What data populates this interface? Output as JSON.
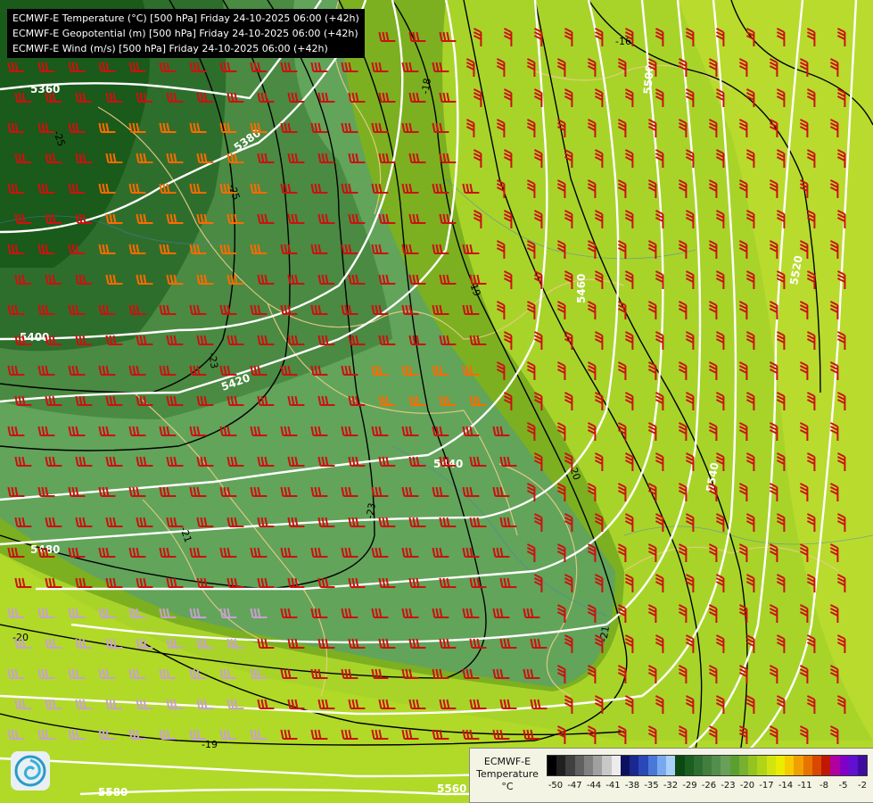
{
  "titles": [
    "ECMWF-E Temperature (°C) [500 hPa] Friday 24-10-2025 06:00 (+42h)",
    "ECMWF-E Geopotential (m) [500 hPa] Friday 24-10-2025 06:00 (+42h)",
    "ECMWF-E Wind (m/s) [500 hPa] Friday 24-10-2025 06:00 (+42h)"
  ],
  "legend": {
    "model": "ECMWF-E",
    "variable": "Temperature",
    "unit": "°C",
    "ticks": [
      "-50",
      "-47",
      "-44",
      "-41",
      "-38",
      "-35",
      "-32",
      "-29",
      "-26",
      "-23",
      "-20",
      "-17",
      "-14",
      "-11",
      "-8",
      "-5",
      "-2"
    ],
    "colors": [
      "#000000",
      "#202020",
      "#404040",
      "#606060",
      "#808080",
      "#a0a0a0",
      "#c8c8c8",
      "#ececec",
      "#0c1060",
      "#1a2890",
      "#2a48b8",
      "#4a78d8",
      "#78a8f0",
      "#a8d0f8",
      "#0a4a12",
      "#1c5e20",
      "#2e6e30",
      "#427e3e",
      "#548e4c",
      "#68a05a",
      "#5aa030",
      "#78b030",
      "#94c420",
      "#b2d418",
      "#d2e410",
      "#ecec00",
      "#f6cc00",
      "#f0a000",
      "#e87400",
      "#d84800",
      "#c01800",
      "#b000a0",
      "#8000c8",
      "#6010d0",
      "#400ca0"
    ]
  },
  "geopotential_labels": [
    "5360",
    "5380",
    "5400",
    "5420",
    "5440",
    "5460",
    "5480",
    "5500",
    "5520",
    "5540",
    "5560",
    "5580"
  ],
  "temperature_labels": [
    "-16",
    "-18",
    "-19",
    "-19",
    "-20",
    "-20",
    "-21",
    "-21",
    "-23",
    "-23",
    "-25",
    "-25"
  ],
  "icons": {
    "logo": "ecmwf-swirl-logo-icon",
    "barb": "wind-barb-icon"
  },
  "colors": {
    "title_bg": "#000000",
    "isohypse": "#ffffff",
    "isotherm": "#000000",
    "barb_red": "#cc1111",
    "barb_orange": "#ff6a00",
    "barb_pink": "#c8a0d0"
  }
}
